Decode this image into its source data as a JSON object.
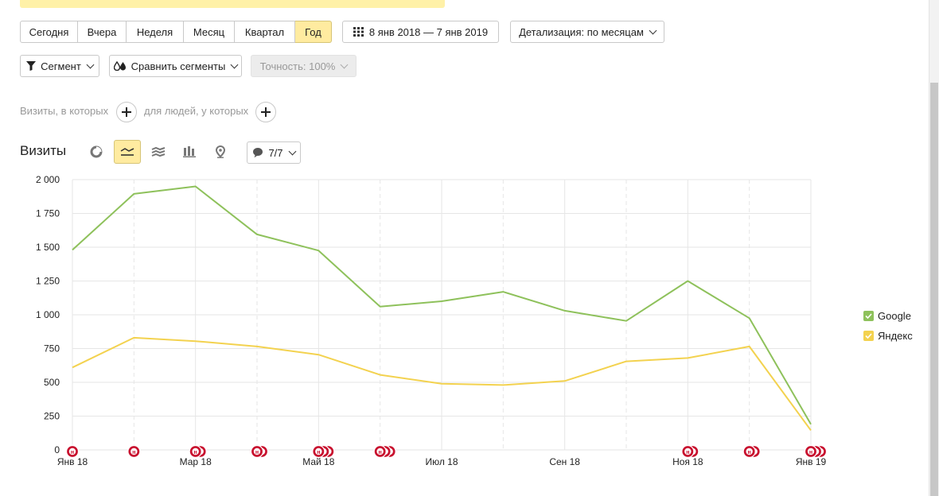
{
  "periods": [
    "Сегодня",
    "Вчера",
    "Неделя",
    "Месяц",
    "Квартал",
    "Год"
  ],
  "active_period": "Год",
  "date_range": "8 янв 2018 — 7 янв 2019",
  "detail": "Детализация: по месяцам",
  "segment_label": "Сегмент",
  "compare_label": "Сравнить сегменты",
  "accuracy_label": "Точность: 100%",
  "filter_visits": "Визиты, в которых",
  "filter_people": "для людей, у которых",
  "chart_section_title": "Визиты",
  "annotations_count": "7/7",
  "icons": {
    "calendar": "calendar-icon",
    "filter": "funnel-icon",
    "compare": "drops-icon",
    "plus": "plus-icon",
    "pie": "pie-icon",
    "line": "line-chart-icon",
    "area": "area-chart-icon",
    "bars": "bar-chart-icon",
    "map": "map-pin-icon",
    "comment": "comment-icon"
  },
  "colors": {
    "google": "#8ec15b",
    "yandex": "#f3d24f",
    "accent": "#ffeba0",
    "marker": "#c8102e"
  },
  "chart_data": {
    "type": "line",
    "title": "Визиты",
    "x_ticks": [
      "Янв 18",
      "Мар 18",
      "Май 18",
      "Июл 18",
      "Сен 18",
      "Ноя 18",
      "Янв 19"
    ],
    "x_tick_positions": [
      0,
      2,
      4,
      6,
      8,
      10,
      12
    ],
    "x": [
      0,
      1,
      2,
      3,
      4,
      5,
      6,
      7,
      8,
      9,
      10,
      11,
      12
    ],
    "y_ticks": [
      "0",
      "250",
      "500",
      "750",
      "1 000",
      "1 250",
      "1 500",
      "1 750",
      "2 000"
    ],
    "ylim": [
      0,
      2000
    ],
    "grid": true,
    "legend_position": "right",
    "series": [
      {
        "name": "Google",
        "values": [
          1480,
          1895,
          1950,
          1595,
          1475,
          1060,
          1100,
          1170,
          1030,
          955,
          1250,
          975,
          190
        ]
      },
      {
        "name": "Яндекс",
        "values": [
          610,
          830,
          805,
          765,
          705,
          555,
          490,
          480,
          510,
          655,
          680,
          765,
          145
        ]
      }
    ],
    "annotation_groups": [
      {
        "x": 0,
        "count": 1
      },
      {
        "x": 1,
        "count": 1
      },
      {
        "x": 2,
        "count": 2
      },
      {
        "x": 3,
        "count": 2
      },
      {
        "x": 4,
        "count": 3
      },
      {
        "x": 5,
        "count": 3
      },
      {
        "x": 10,
        "count": 2
      },
      {
        "x": 11,
        "count": 2
      },
      {
        "x": 12,
        "count": 3
      }
    ],
    "annotation_glyph": "н"
  }
}
